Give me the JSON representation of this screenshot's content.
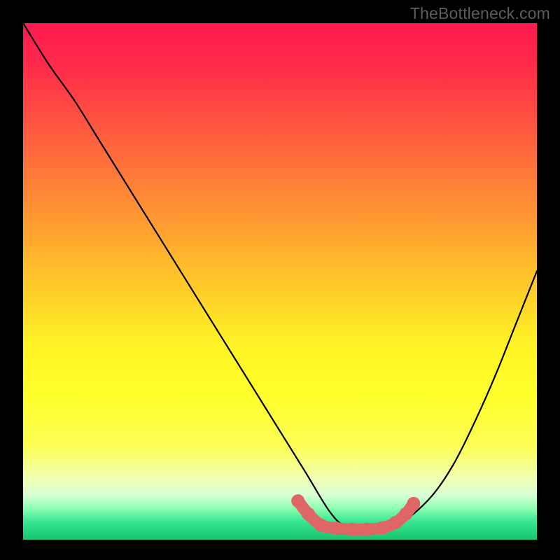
{
  "watermark": "TheBottleneck.com",
  "colors": {
    "gradient_stops": [
      {
        "offset": 0.0,
        "color": "#ff1a50"
      },
      {
        "offset": 0.08,
        "color": "#ff2a4a"
      },
      {
        "offset": 0.2,
        "color": "#ff5740"
      },
      {
        "offset": 0.35,
        "color": "#ff8e34"
      },
      {
        "offset": 0.5,
        "color": "#ffc72a"
      },
      {
        "offset": 0.62,
        "color": "#fff225"
      },
      {
        "offset": 0.72,
        "color": "#ffff2a"
      },
      {
        "offset": 0.82,
        "color": "#fbff55"
      },
      {
        "offset": 0.88,
        "color": "#f2ffb0"
      },
      {
        "offset": 0.915,
        "color": "#d6ffd6"
      },
      {
        "offset": 0.94,
        "color": "#8affb0"
      },
      {
        "offset": 0.965,
        "color": "#38e692"
      },
      {
        "offset": 1.0,
        "color": "#18c46e"
      }
    ],
    "curve": "#000000",
    "marker_fill": "#e06666",
    "marker_stroke": "#d85a5a"
  },
  "chart_data": {
    "type": "line",
    "title": "",
    "xlabel": "",
    "ylabel": "",
    "xlim": [
      0,
      100
    ],
    "ylim": [
      0,
      100
    ],
    "grid": false,
    "series": [
      {
        "name": "bottleneck-curve",
        "x": [
          0,
          5,
          10,
          15,
          20,
          25,
          30,
          35,
          40,
          45,
          50,
          55,
          58,
          60,
          62,
          65,
          68,
          70,
          73,
          76,
          80,
          84,
          88,
          92,
          96,
          100
        ],
        "y": [
          100,
          92,
          85,
          77,
          69,
          61,
          53,
          45,
          37,
          29,
          21,
          13,
          8,
          5,
          3,
          2,
          2,
          2,
          3,
          5,
          9,
          15,
          23,
          32,
          42,
          52
        ]
      }
    ],
    "markers": {
      "name": "highlight-segment",
      "x": [
        53.5,
        55.5,
        58,
        61,
        64,
        67,
        70,
        72.5,
        74.5,
        76
      ],
      "y": [
        7.5,
        5.0,
        2.8,
        2.2,
        2.0,
        2.0,
        2.3,
        3.3,
        5.0,
        7.0
      ],
      "count": 10
    }
  }
}
